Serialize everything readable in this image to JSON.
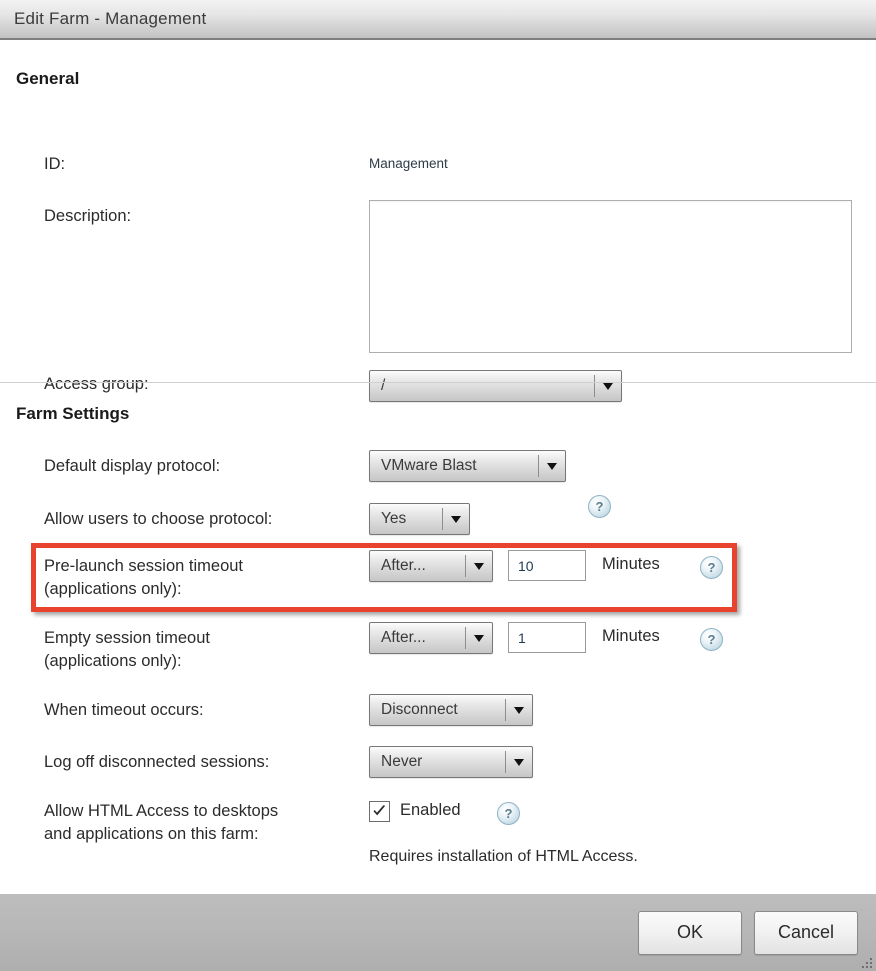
{
  "window": {
    "title": "Edit Farm - Management",
    "accent_highlight_color": "#e8432e"
  },
  "sections": {
    "general": {
      "title": "General",
      "id_label": "ID:",
      "id_value": "Management",
      "description_label": "Description:",
      "description_value": "",
      "access_group_label": "Access group:",
      "access_group_value": "/"
    },
    "farm_settings": {
      "title": "Farm Settings",
      "rows": {
        "default_protocol": {
          "label": "Default display protocol:",
          "value": "VMware Blast",
          "help": "?"
        },
        "allow_choose_protocol": {
          "label": "Allow users to choose protocol:",
          "value": "Yes"
        },
        "prelaunch_timeout": {
          "label": "Pre-launch session timeout\n(applications only):",
          "select_value": "After...",
          "number_value": "10",
          "unit": "Minutes",
          "help": "?",
          "highlighted": true
        },
        "empty_timeout": {
          "label": "Empty session timeout\n(applications only):",
          "select_value": "After...",
          "number_value": "1",
          "unit": "Minutes",
          "help": "?"
        },
        "when_timeout": {
          "label": "When timeout occurs:",
          "value": "Disconnect"
        },
        "logoff_disconnected": {
          "label": "Log off disconnected sessions:",
          "value": "Never"
        },
        "html_access": {
          "label": "Allow HTML Access to desktops\nand applications on this farm:",
          "checkbox_label": "Enabled",
          "checked": true,
          "help": "?",
          "note": "Requires installation of HTML Access."
        }
      }
    }
  },
  "footer": {
    "ok_label": "OK",
    "cancel_label": "Cancel"
  },
  "icons": {
    "help": "help-circle-icon",
    "chevron": "chevron-down-icon",
    "check": "check-icon",
    "grip": "resize-grip-icon"
  }
}
